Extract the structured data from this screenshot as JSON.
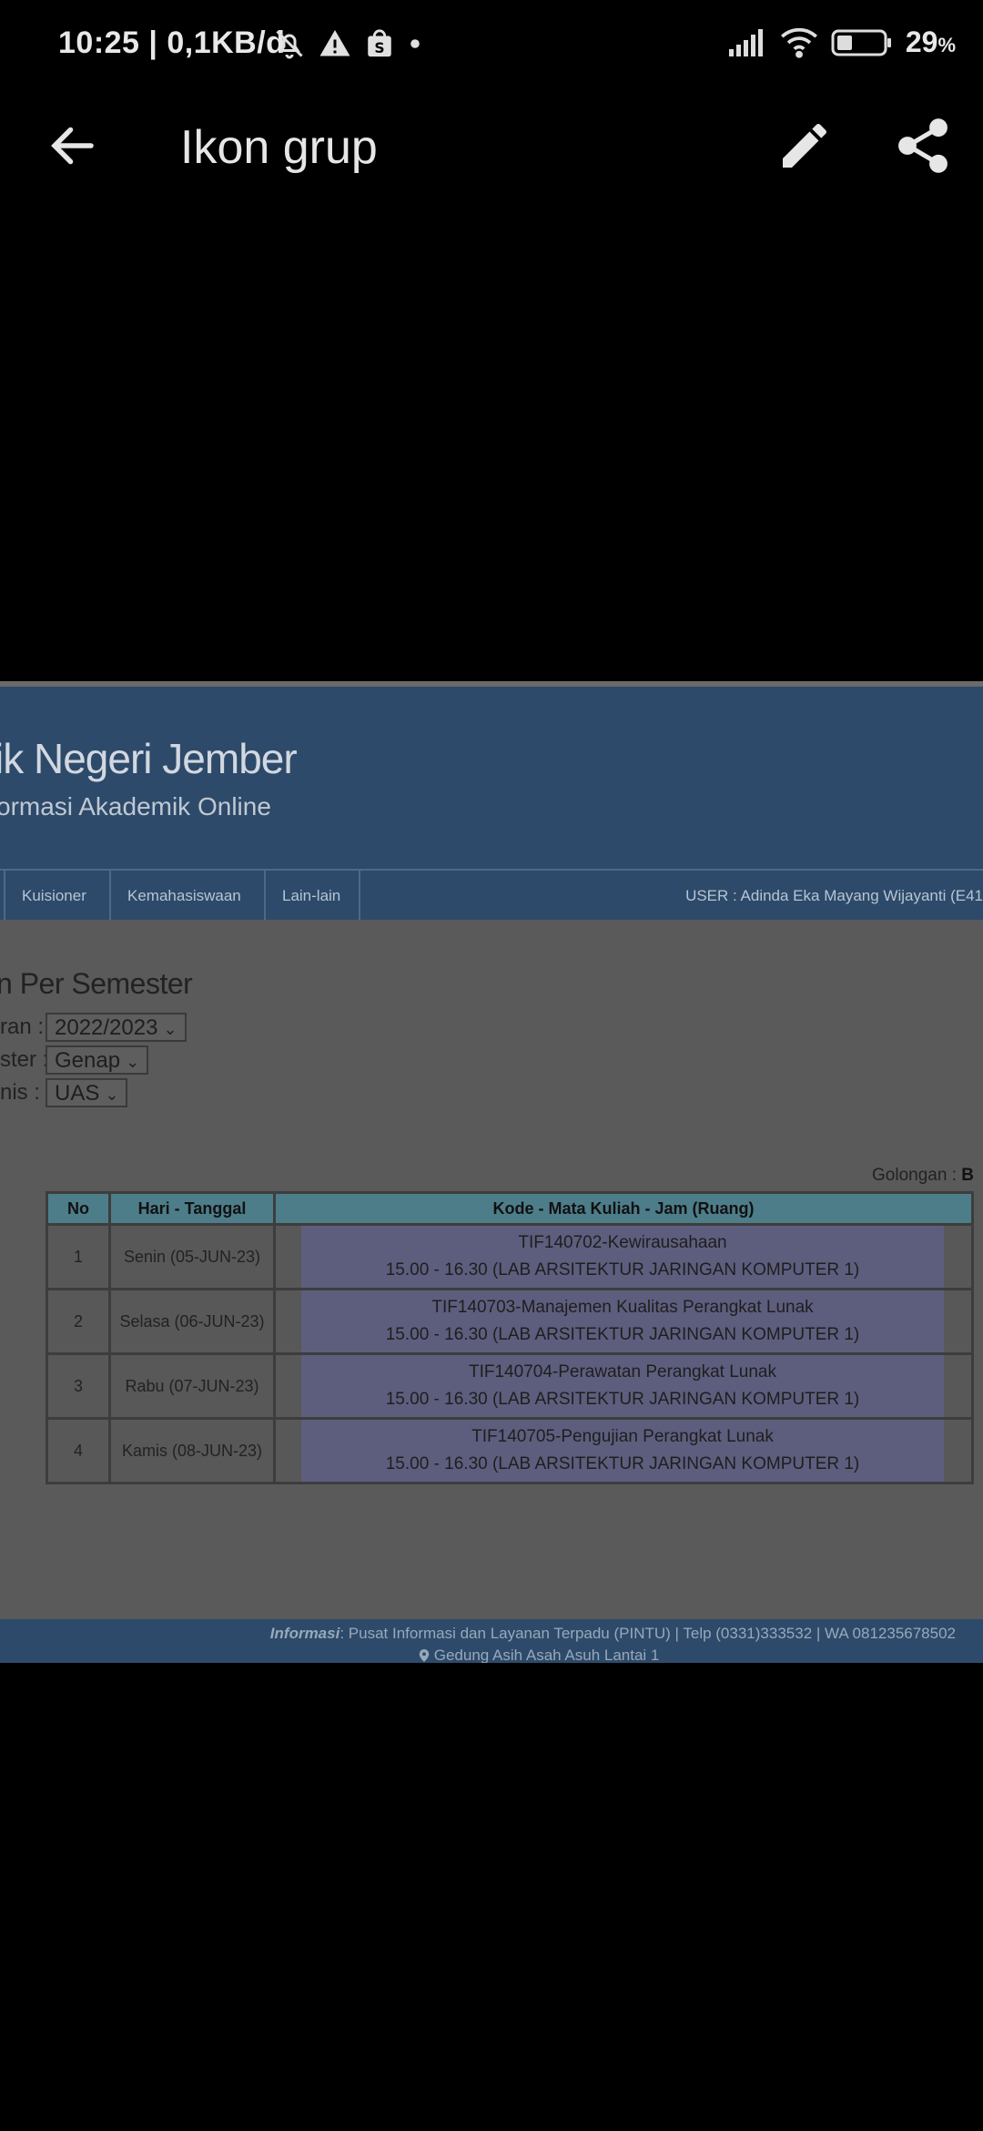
{
  "status_bar": {
    "time_speed": "10:25 | 0,1KB/d",
    "battery_percent": "29",
    "battery_unit": "%"
  },
  "app_bar": {
    "title": "Ikon grup"
  },
  "page": {
    "banner_title": "ik Negeri Jember",
    "banner_subtitle": "ormasi Akademik Online",
    "nav": {
      "items": [
        "Kuisioner",
        "Kemahasiswaan",
        "Lain-lain"
      ],
      "user": "USER : Adinda Eka Mayang Wijayanti (E41"
    },
    "heading": "n Per Semester",
    "filters": [
      {
        "label": "ran :",
        "value": "2022/2023"
      },
      {
        "label": "ster :",
        "value": "Genap"
      },
      {
        "label": "nis :",
        "value": "UAS"
      }
    ],
    "golongan_label": "Golongan :",
    "golongan_value": "B",
    "table": {
      "headers": [
        "No",
        "Hari - Tanggal",
        "Kode - Mata Kuliah - Jam (Ruang)"
      ],
      "rows": [
        {
          "no": "1",
          "day": "Senin (05-JUN-23)",
          "course": "TIF140702-Kewirausahaan",
          "time": "15.00 - 16.30 (LAB ARSITEKTUR JARINGAN KOMPUTER 1)"
        },
        {
          "no": "2",
          "day": "Selasa (06-JUN-23)",
          "course": "TIF140703-Manajemen Kualitas Perangkat Lunak",
          "time": "15.00 - 16.30 (LAB ARSITEKTUR JARINGAN KOMPUTER 1)"
        },
        {
          "no": "3",
          "day": "Rabu (07-JUN-23)",
          "course": "TIF140704-Perawatan Perangkat Lunak",
          "time": "15.00 - 16.30 (LAB ARSITEKTUR JARINGAN KOMPUTER 1)"
        },
        {
          "no": "4",
          "day": "Kamis (08-JUN-23)",
          "course": "TIF140705-Pengujian Perangkat Lunak",
          "time": "15.00 - 16.30 (LAB ARSITEKTUR JARINGAN KOMPUTER 1)"
        }
      ]
    },
    "footer": {
      "info_label": "Informasi",
      "info_text": ": Pusat Informasi dan Layanan Terpadu (PINTU) | Telp (0331)333532 | WA 081235678502",
      "address": "Gedung Asih Asah Asuh Lantai 1"
    }
  }
}
